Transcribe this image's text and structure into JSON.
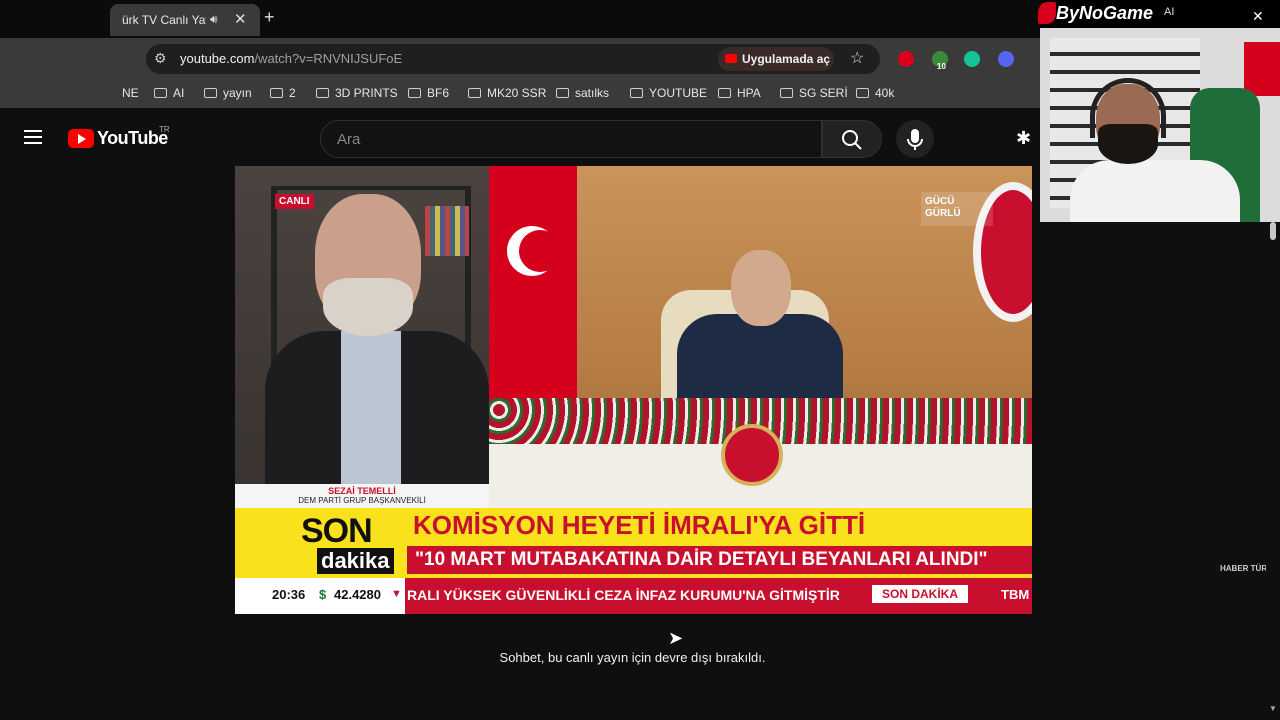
{
  "browser": {
    "tab_title": "ürk TV Canlı Yayı",
    "url_host": "youtube.com",
    "url_path": "/watch?v=RNVNIJSUFoE",
    "open_in_app": "Uygulamada aç",
    "bookmarks": [
      "NE",
      "AI",
      "yayın",
      "2",
      "3D PRINTS",
      "BF6",
      "MK20 SSR",
      "satılks",
      "YOUTUBE",
      "HPA",
      "SG SERİ",
      "40k"
    ],
    "extensions_badge": "10"
  },
  "youtube": {
    "logo_text": "YouTube",
    "country_code": "TR",
    "search_placeholder": "Ara"
  },
  "video": {
    "live_badge": "CANLI",
    "guest_name": "SEZAİ TEMELLİ",
    "guest_role": "DEM PARTİ GRUP BAŞKANVEKİLİ",
    "channel_bug": "GÜCÜ GÜRLÜ",
    "son": "SON",
    "dakika": "dakika",
    "headline": "KOMİSYON HEYETİ İMRALI'YA GİTTİ",
    "subheadline": "\"10 MART MUTABAKATINA DAİR DETAYLI BEYANLARI ALINDI\"",
    "clock": "20:36",
    "currency_symbol": "$",
    "exchange_rate": "42.4280",
    "ticker": "RALI YÜKSEK GÜVENLİKLİ CEZA İNFAZ KURUMU'NA GİTMİŞTİR",
    "ticker_badge": "SON DAKİKA",
    "ticker_tail": "TBM",
    "watermark": "HABER TÜRK"
  },
  "chat": {
    "disabled_message": "Sohbet, bu canlı yayın için devre dışı bırakıldı."
  },
  "overlay": {
    "brand_name": "ByNoGame",
    "brand_extra": "AI"
  },
  "colors": {
    "youtube_red": "#ff0000",
    "news_red": "#c8102e",
    "news_yellow": "#f9e11c"
  }
}
